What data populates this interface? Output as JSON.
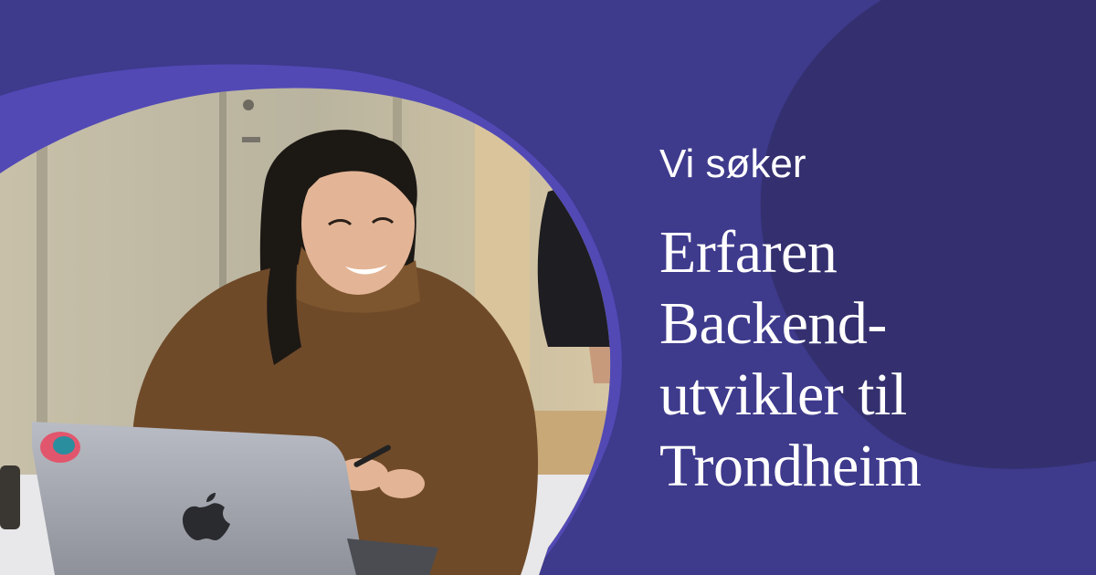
{
  "colors": {
    "background": "#3e3a8c",
    "accent_purple": "#5249b5",
    "dark_blob": "#34306f",
    "text": "#ffffff"
  },
  "eyebrow": "Vi søker",
  "headline": {
    "line1": "Erfaren",
    "line2": "Backend-",
    "line3": "utvikler til",
    "line4": "Trondheim"
  },
  "photo": {
    "subject": "smiling-person-at-laptop-photo",
    "laptop_logo": "apple-logo-icon"
  }
}
